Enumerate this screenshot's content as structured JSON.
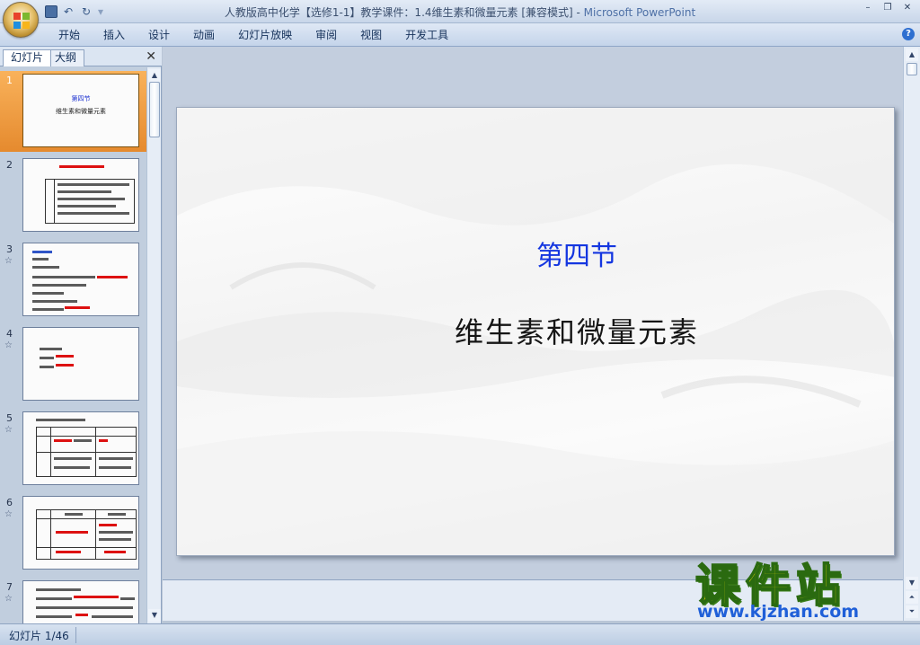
{
  "window": {
    "title_main": "人教版高中化学【选修1-1】教学课件：1.4维生素和微量元素 [兼容模式] - ",
    "title_app": "Microsoft PowerPoint"
  },
  "quick_access": {
    "undo_glyph": "↶",
    "redo_glyph": "↻",
    "customize_glyph": "▾"
  },
  "window_controls": {
    "minimize": "–",
    "restore": "❐",
    "close": "✕"
  },
  "ribbon": {
    "tabs": [
      "开始",
      "插入",
      "设计",
      "动画",
      "幻灯片放映",
      "审阅",
      "视图",
      "开发工具"
    ],
    "help": "?"
  },
  "left_pane": {
    "tab_slides": "幻灯片",
    "tab_outline": "大纲",
    "close_glyph": "✕",
    "anim_glyph": "☆",
    "thumbnails": [
      {
        "number": "1",
        "selected": true,
        "title": "第四节",
        "subtitle": "维生素和微量元素"
      },
      {
        "number": "2",
        "selected": false
      },
      {
        "number": "3",
        "selected": false
      },
      {
        "number": "4",
        "selected": false
      },
      {
        "number": "5",
        "selected": false
      },
      {
        "number": "6",
        "selected": false
      },
      {
        "number": "7",
        "selected": false
      }
    ]
  },
  "slide": {
    "title": "第四节",
    "subtitle": "维生素和微量元素",
    "title_color": "#1436e0"
  },
  "watermark": {
    "text_cn": "课件站",
    "url": "www.kjzhan.com"
  },
  "statusbar": {
    "slide_info": "幻灯片 1/46"
  },
  "colors": {
    "selection": "#f0a04b",
    "accent": "#2e6fd0"
  }
}
